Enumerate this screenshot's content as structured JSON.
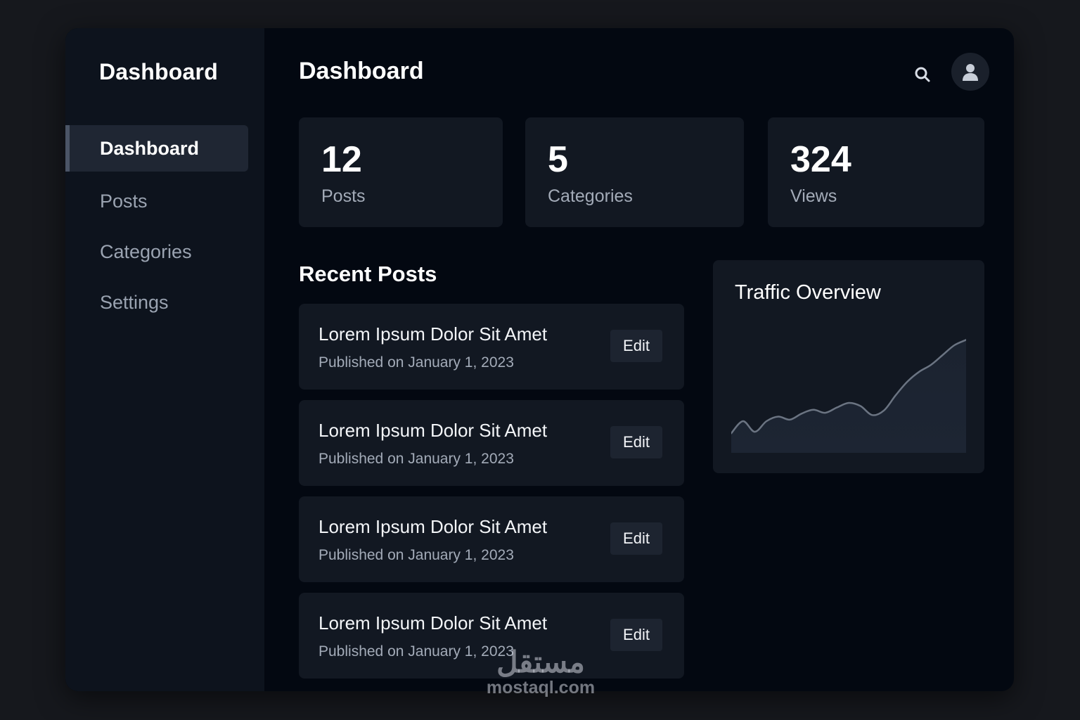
{
  "sidebar": {
    "title": "Dashboard",
    "items": [
      {
        "label": "Dashboard",
        "active": true
      },
      {
        "label": "Posts",
        "active": false
      },
      {
        "label": "Categories",
        "active": false
      },
      {
        "label": "Settings",
        "active": false
      }
    ]
  },
  "header": {
    "title": "Dashboard",
    "icons": [
      "search-icon",
      "user-icon"
    ]
  },
  "stats": [
    {
      "value": "12",
      "label": "Posts"
    },
    {
      "value": "5",
      "label": "Categories"
    },
    {
      "value": "324",
      "label": "Views"
    }
  ],
  "recent_posts": {
    "title": "Recent Posts",
    "items": [
      {
        "title": "Lorem Ipsum Dolor Sit Amet",
        "date": "Published on January 1, 2023",
        "action": "Edit"
      },
      {
        "title": "Lorem Ipsum Dolor Sit Amet",
        "date": "Published on January 1, 2023",
        "action": "Edit"
      },
      {
        "title": "Lorem Ipsum Dolor Sit Amet",
        "date": "Published on January 1, 2023",
        "action": "Edit"
      },
      {
        "title": "Lorem Ipsum Dolor Sit Amet",
        "date": "Published on January 1, 2023",
        "action": "Edit"
      }
    ]
  },
  "traffic": {
    "title": "Traffic Overview",
    "chart_data": {
      "type": "area",
      "values": [
        22,
        38,
        24,
        38,
        44,
        40,
        48,
        53,
        49,
        56,
        62,
        58,
        46,
        52,
        72,
        90,
        103,
        112,
        125,
        138,
        145
      ],
      "title": "",
      "xlabel": "",
      "ylabel": ""
    }
  },
  "watermark": {
    "arabic": "مستقل",
    "latin": "mostaql.com"
  },
  "colors": {
    "page_background": "#16181d",
    "main_background": "#030811",
    "sidebar_background": "#0d131d",
    "card_background": "#121822",
    "active_nav_background": "#1f2633",
    "text_primary": "#ffffff",
    "text_secondary": "#a3abb8"
  }
}
